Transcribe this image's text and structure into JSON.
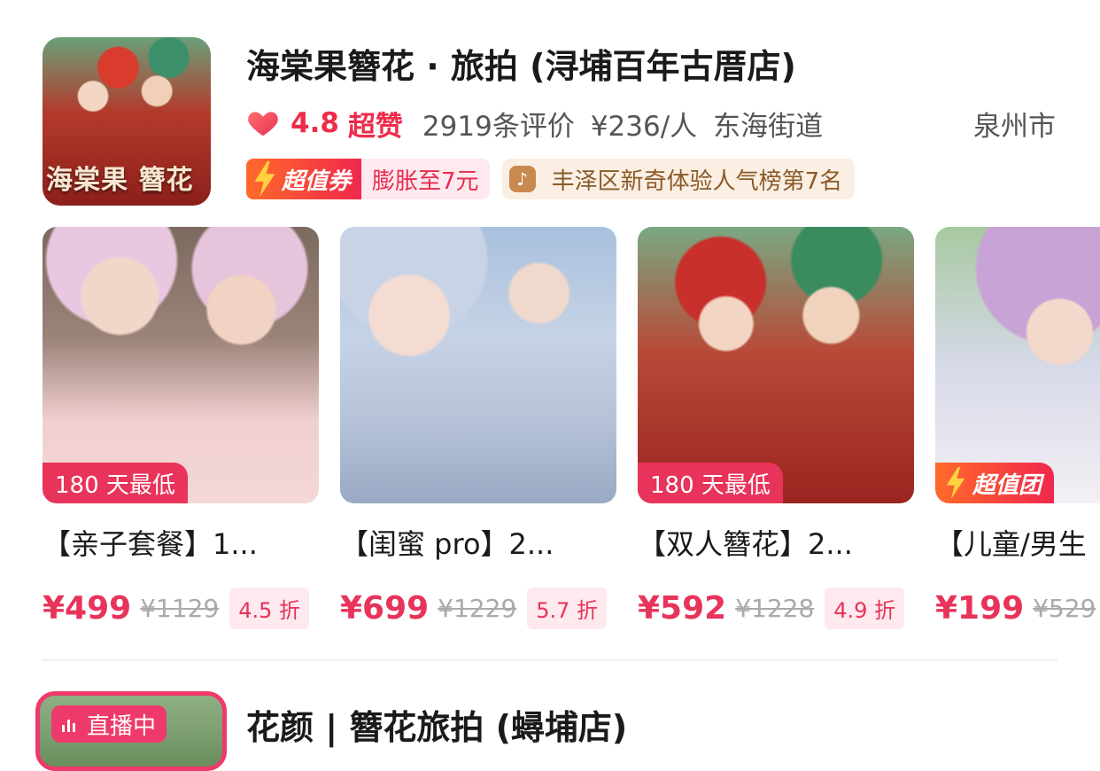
{
  "store": {
    "name": "海棠果簪花 · 旅拍 (浔埔百年古厝店)",
    "logo_text": "海棠果 簪花",
    "rating": "4.8",
    "rating_tag": "超赞",
    "reviews": "2919条评价",
    "price_per_person": "¥236/人",
    "area": "东海街道",
    "city": "泉州市",
    "coupon_label": "超值券",
    "coupon_text": "膨胀至7元",
    "rank_icon": "douyin-icon",
    "rank_text": "丰泽区新奇体验人气榜第7名"
  },
  "products": [
    {
      "ribbon": "180 天最低",
      "ribbon_style": "pink",
      "title": "【亲子套餐】1...",
      "price": "¥499",
      "original": "¥1129",
      "discount": "4.5 折"
    },
    {
      "ribbon": "",
      "ribbon_style": "none",
      "title": "【闺蜜 pro】2...",
      "price": "¥699",
      "original": "¥1229",
      "discount": "5.7 折"
    },
    {
      "ribbon": "180 天最低",
      "ribbon_style": "pink",
      "title": "【双人簪花】2...",
      "price": "¥592",
      "original": "¥1228",
      "discount": "4.9 折"
    },
    {
      "ribbon": "超值团",
      "ribbon_style": "orange",
      "title": "【儿童/男生",
      "price": "¥199",
      "original": "¥529",
      "discount": ""
    }
  ],
  "store2": {
    "live_label": "直播中",
    "name": "花颜 | 簪花旅拍 (蟳埔店)"
  },
  "colors": {
    "accent": "#e8335a",
    "coupon_orange": "#ff6a2a",
    "live": "#ee3a6a"
  }
}
